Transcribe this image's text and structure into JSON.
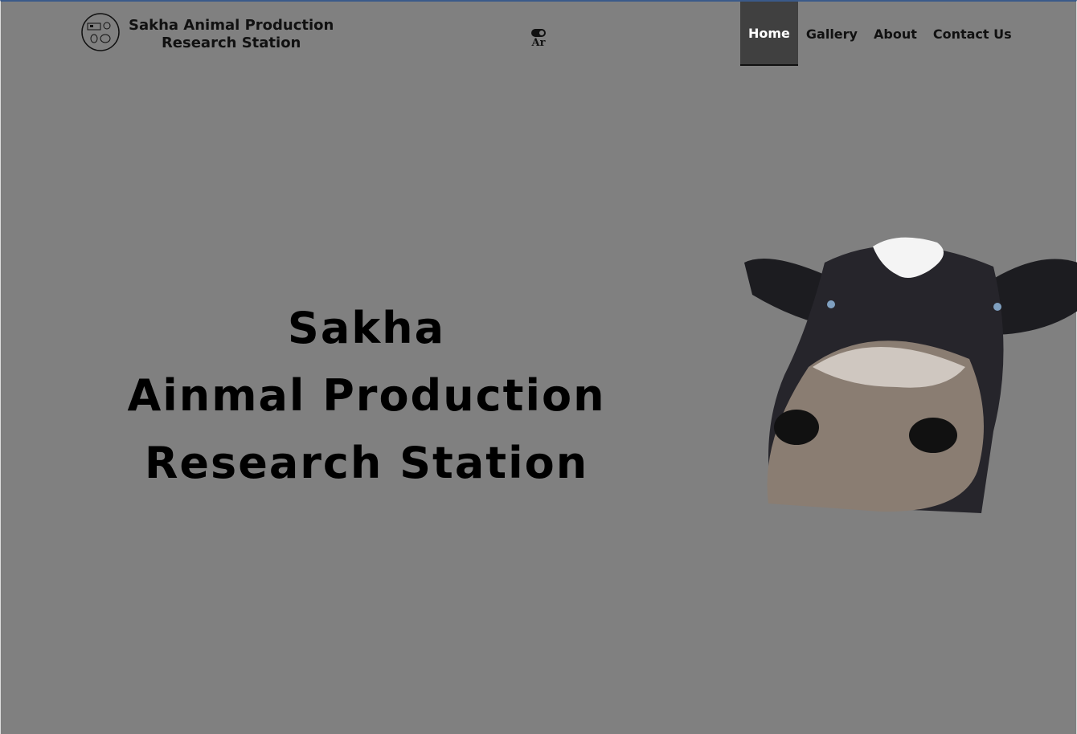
{
  "header": {
    "brand_line1": "Sakha Animal Production",
    "brand_line2": "Research Station",
    "language_toggle": "Ar",
    "nav": [
      {
        "label": "Home",
        "active": true
      },
      {
        "label": "Gallery"
      },
      {
        "label": "About"
      },
      {
        "label": "Contact Us"
      }
    ]
  },
  "hero": {
    "line1": "Sakha",
    "line2": "Ainmal Production",
    "line3": "Research Station"
  },
  "colors": {
    "background": "#808080",
    "active_nav": "#404040"
  }
}
